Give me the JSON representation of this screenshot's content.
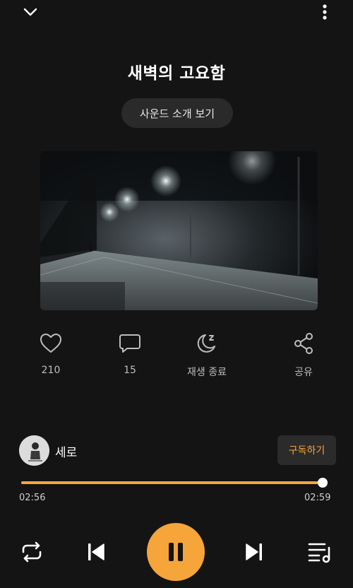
{
  "header": {
    "collapse_icon": "chevron-down-icon",
    "more_icon": "more-vertical-icon"
  },
  "track": {
    "title": "새벽의 고요함",
    "sound_intro_label": "사운드 소개 보기"
  },
  "artwork": {
    "description_icon": "album-artwork"
  },
  "actions": [
    {
      "icon": "heart-icon",
      "label": "210"
    },
    {
      "icon": "comment-icon",
      "label": "15"
    },
    {
      "icon": "moon-sleep-icon",
      "label": "재생 종료"
    },
    {
      "icon": "share-icon",
      "label": "공유"
    }
  ],
  "artist": {
    "name": "세로",
    "subscribe_label": "구독하기"
  },
  "playback": {
    "current_time": "02:56",
    "total_time": "02:59",
    "progress": 0.983,
    "is_playing": true
  },
  "controls": {
    "repeat_icon": "repeat-icon",
    "prev_icon": "skip-previous-icon",
    "pause_icon": "pause-icon",
    "next_icon": "skip-next-icon",
    "playlist_icon": "playlist-icon"
  },
  "colors": {
    "background": "#141414",
    "accent": "#f6a53a",
    "subscribe_text": "#f6a43a",
    "secondary_text": "#bdbdbd"
  }
}
